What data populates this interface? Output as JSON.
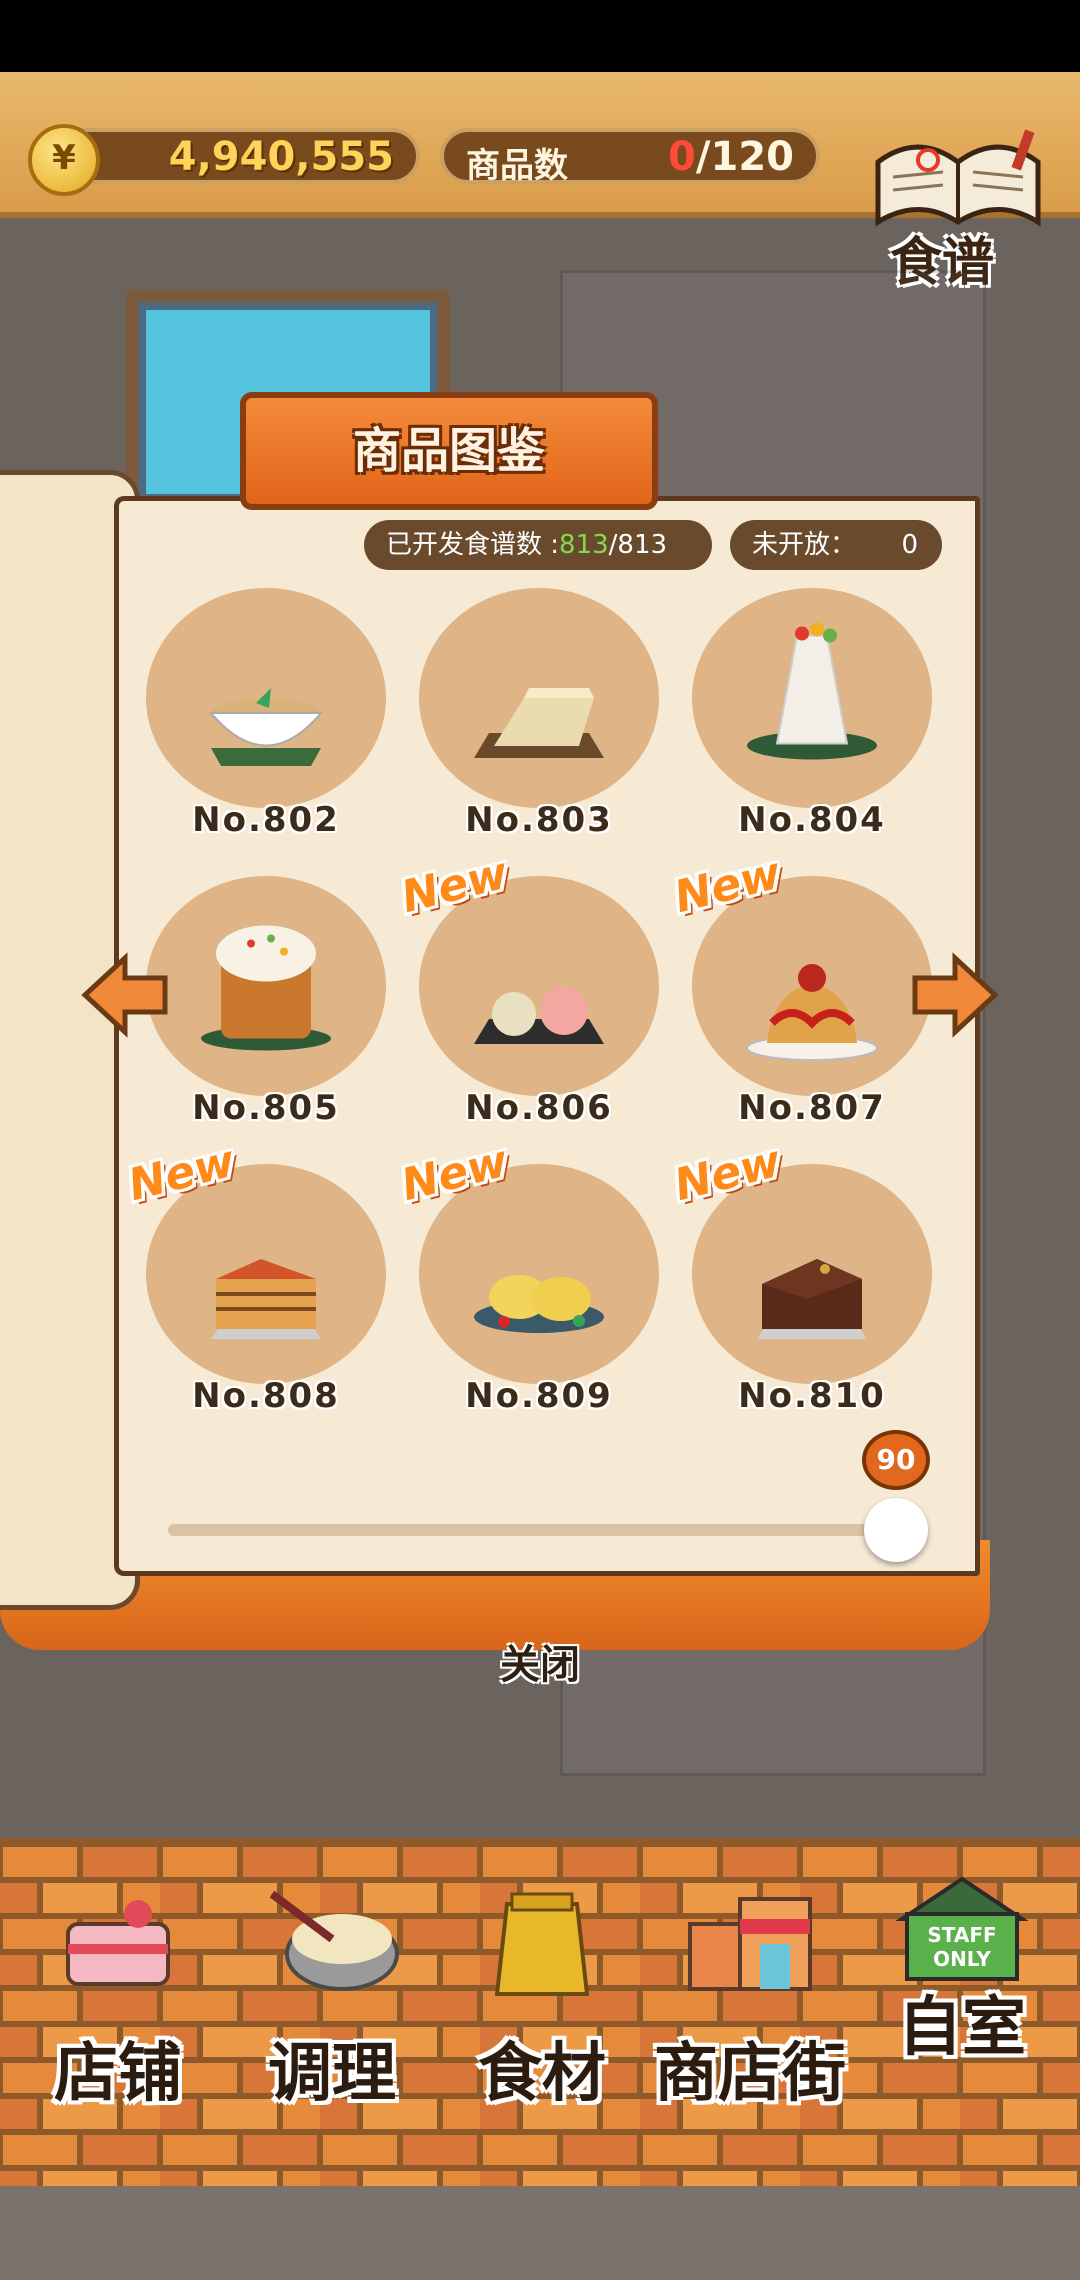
{
  "header": {
    "money": "4,940,555",
    "coin_symbol": "¥",
    "goods_label": "商品数",
    "goods_current": "0",
    "goods_total": "/120",
    "recipe_label": "食谱"
  },
  "book": {
    "title": "商品图鉴",
    "developed_label": "已开发食谱数 :",
    "developed_count": "813",
    "developed_total": "/813",
    "closed_label": "未开放：",
    "closed_count": "0",
    "items": [
      {
        "label": "No.802",
        "is_new": false,
        "food_icon": "rice-bowl-icon"
      },
      {
        "label": "No.803",
        "is_new": false,
        "food_icon": "tofu-block-icon"
      },
      {
        "label": "No.804",
        "is_new": false,
        "food_icon": "paskha-cake-icon"
      },
      {
        "label": "No.805",
        "is_new": false,
        "food_icon": "kulich-bread-icon"
      },
      {
        "label": "No.806",
        "is_new": true,
        "food_icon": "buns-plate-icon"
      },
      {
        "label": "No.807",
        "is_new": true,
        "food_icon": "dessert-sauce-icon"
      },
      {
        "label": "No.808",
        "is_new": true,
        "food_icon": "layer-cake-slice-icon"
      },
      {
        "label": "No.809",
        "is_new": true,
        "food_icon": "pancakes-plate-icon"
      },
      {
        "label": "No.810",
        "is_new": true,
        "food_icon": "chocolate-cake-slice-icon"
      }
    ],
    "new_badge": "New",
    "slider_value": "90",
    "close_label": "关闭"
  },
  "nav": {
    "items": [
      {
        "label": "店铺",
        "icon": "shop-cake-icon"
      },
      {
        "label": "调理",
        "icon": "cooking-bowl-icon"
      },
      {
        "label": "食材",
        "icon": "ingredient-bag-icon"
      },
      {
        "label": "商店街",
        "icon": "shopping-street-icon"
      },
      {
        "label": "自室",
        "icon": "staff-room-icon"
      }
    ],
    "staff_sign": "STAFF ONLY"
  },
  "colors": {
    "accent_orange": "#e0651a",
    "new_orange": "#ff8a1a",
    "developed_green": "#7fdc4a",
    "zero_red": "#ff4a3a",
    "brick": "#c9652a"
  }
}
